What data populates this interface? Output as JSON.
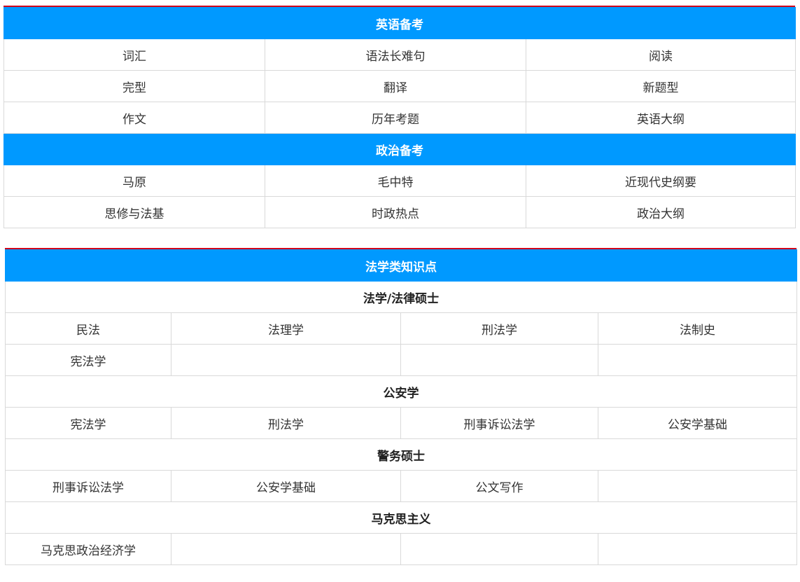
{
  "section1": {
    "english": {
      "title": "英语备考",
      "rows": [
        [
          "词汇",
          "语法长难句",
          "阅读"
        ],
        [
          "完型",
          "翻译",
          "新题型"
        ],
        [
          "作文",
          "历年考题",
          "英语大纲"
        ]
      ]
    },
    "politics": {
      "title": "政治备考",
      "rows": [
        [
          "马原",
          "毛中特",
          "近现代史纲要"
        ],
        [
          "思修与法基",
          "时政热点",
          "政治大纲"
        ]
      ]
    }
  },
  "section2": {
    "title": "法学类知识点",
    "groups": [
      {
        "title": "法学/法律硕士",
        "rows": [
          [
            "民法",
            "法理学",
            "刑法学",
            "法制史"
          ],
          [
            "宪法学",
            "",
            "",
            ""
          ]
        ]
      },
      {
        "title": "公安学",
        "rows": [
          [
            "宪法学",
            "刑法学",
            "刑事诉讼法学",
            "公安学基础"
          ]
        ]
      },
      {
        "title": "警务硕士",
        "rows": [
          [
            "刑事诉讼法学",
            "公安学基础",
            "公文写作",
            ""
          ]
        ]
      },
      {
        "title": "马克思主义",
        "rows": [
          [
            "马克思政治经济学",
            "",
            "",
            ""
          ]
        ]
      }
    ]
  }
}
